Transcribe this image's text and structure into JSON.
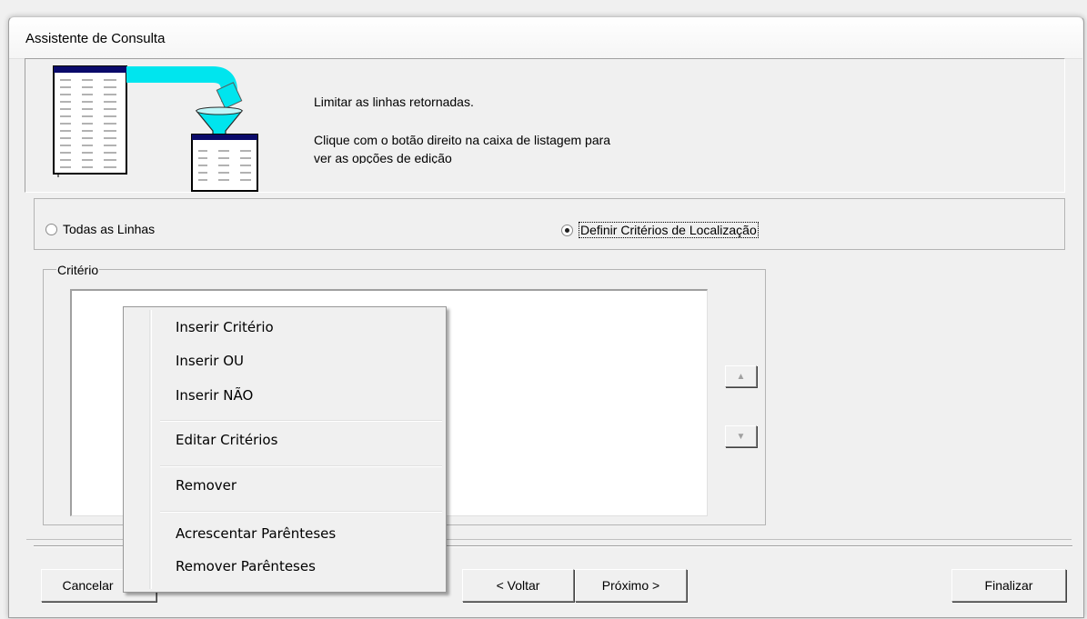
{
  "window": {
    "title": "Assistente de Consulta"
  },
  "header": {
    "line1": "Limitar as linhas retornadas.",
    "line2": "Clique com o botão direito na caixa de listagem para",
    "line3": "ver as opções de edição"
  },
  "options": {
    "all_rows": "Todas as Linhas",
    "define_criteria": "Definir Critérios de Localização",
    "selected": "define_criteria"
  },
  "criteria": {
    "group_label": "Critério"
  },
  "context_menu": {
    "items": [
      "Inserir Critério",
      "Inserir OU",
      "Inserir NÃO",
      "Editar Critérios",
      "Remover",
      "Acrescentar Parênteses",
      "Remover Parênteses"
    ]
  },
  "buttons": {
    "cancel": "Cancelar",
    "back": "< Voltar",
    "next": "Próximo >",
    "finish": "Finalizar"
  },
  "icons": {
    "up": "arrow-up-icon",
    "down": "arrow-down-icon",
    "wizard": "table-filter-illustration"
  },
  "colors": {
    "pipe": "#00e5ee",
    "table_header": "#0a0a6a"
  }
}
